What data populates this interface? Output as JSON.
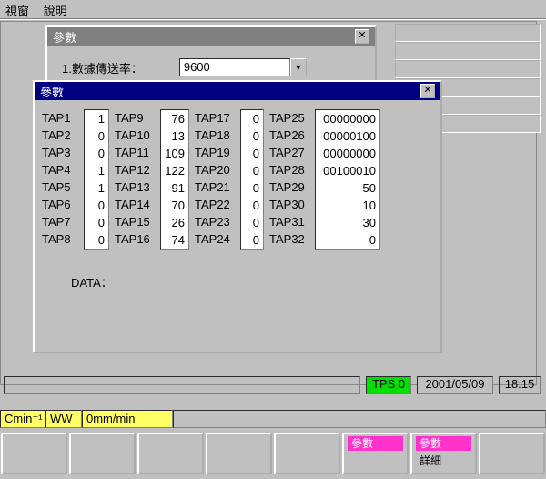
{
  "menu": {
    "window": "視窗",
    "help": "說明"
  },
  "dlg1": {
    "title": "參數",
    "label": "1.數據傳送率：",
    "baud": "9600"
  },
  "dlg2": {
    "title": "參數",
    "taps": {
      "col1_labels": [
        "TAP1",
        "TAP2",
        "TAP3",
        "TAP4",
        "TAP5",
        "TAP6",
        "TAP7",
        "TAP8"
      ],
      "col1_values": [
        "1",
        "0",
        "0",
        "1",
        "1",
        "0",
        "0",
        "0"
      ],
      "col2_labels": [
        "TAP9",
        "TAP10",
        "TAP11",
        "TAP12",
        "TAP13",
        "TAP14",
        "TAP15",
        "TAP16"
      ],
      "col2_values": [
        "76",
        "13",
        "109",
        "122",
        "91",
        "70",
        "26",
        "74"
      ],
      "col3_labels": [
        "TAP17",
        "TAP18",
        "TAP19",
        "TAP20",
        "TAP21",
        "TAP22",
        "TAP23",
        "TAP24"
      ],
      "col3_values": [
        "0",
        "0",
        "0",
        "0",
        "0",
        "0",
        "0",
        "0"
      ],
      "col4_labels": [
        "TAP25",
        "TAP26",
        "TAP27",
        "TAP28",
        "TAP29",
        "TAP30",
        "TAP31",
        "TAP32"
      ],
      "col4_values": [
        "00000000",
        "00000100",
        "00000000",
        "00100010",
        "50",
        "10",
        "30",
        "0"
      ]
    },
    "data_label": "DATA："
  },
  "status": {
    "tps": "TPS 0",
    "date": "2001/05/09",
    "time": "18:15"
  },
  "row2": {
    "cmin": "Cmin⁻¹",
    "ww": "WW",
    "feed": "0mm/min"
  },
  "fkeys": {
    "f6": "參數",
    "f7a": "參數",
    "f7b": "詳細"
  }
}
